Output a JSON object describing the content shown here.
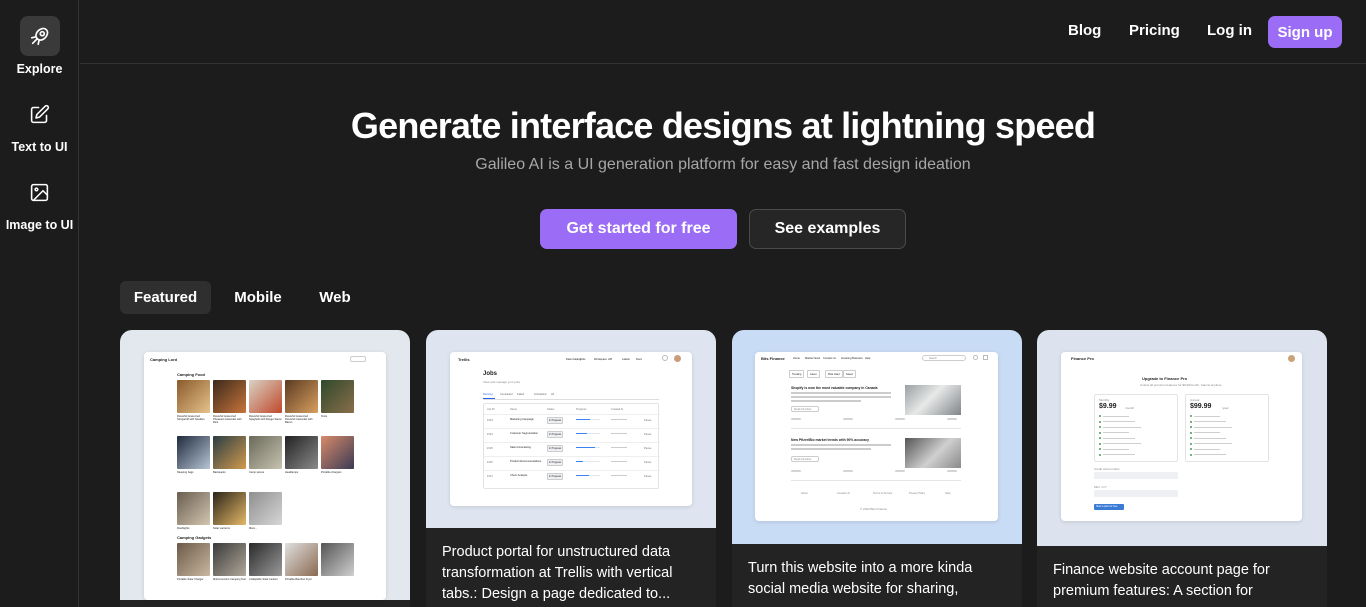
{
  "sidebar": {
    "items": [
      {
        "label": "Explore",
        "icon": "explore-icon",
        "active": true
      },
      {
        "label": "Text to UI",
        "icon": "edit-icon",
        "active": false
      },
      {
        "label": "Image to UI",
        "icon": "image-icon",
        "active": false
      }
    ]
  },
  "header": {
    "nav": {
      "blog": "Blog",
      "pricing": "Pricing",
      "login": "Log in",
      "signup": "Sign up"
    }
  },
  "hero": {
    "title": "Generate interface designs at lightning speed",
    "subtitle": "Galileo AI is a UI generation platform for easy and fast design ideation",
    "cta_primary": "Get started for free",
    "cta_secondary": "See examples"
  },
  "tabs": [
    {
      "label": "Featured",
      "active": true
    },
    {
      "label": "Mobile",
      "active": false
    },
    {
      "label": "Web",
      "active": false
    }
  ],
  "colors": {
    "accent": "#9b6cf5",
    "background": "#1c1c1c"
  },
  "cards": [
    {
      "caption": "",
      "preview": {
        "brand": "Camping Lord",
        "section1": "Camping Food",
        "section2": "Camping Gadgets",
        "food_items": [
          "Flavorful Grass-Fed Stroganoff with Noodles",
          "Flavorful Grass-Fed Pheasant Cassoulet with Rice",
          "Flavorful Grass-Fed Spaghetti with Rouge Sauce",
          "Flavorful Grass-Fed Flavorful Cassoulet with Bacon",
          "Tents",
          "Sleeping bags",
          "Backpacks",
          "Camp stoves",
          "Headlamps",
          "Portable chargers",
          "Flashlights",
          "Solar Lanterns",
          "More..."
        ],
        "gadget_items": [
          "Portable Solar Charger",
          "Multi-Function Camping Tool",
          "Collapsible Solar Lantern",
          "Portable Bamboo Fryer"
        ]
      }
    },
    {
      "caption": "Product portal for unstructured data transformation at Trellis with vertical tabs.: Design a page dedicated to...",
      "preview": {
        "brand": "Trellis",
        "nav": [
          "Data Catalog",
          "Jobs",
          "Workspace",
          "API",
          "Labels",
          "Docs"
        ],
        "title": "Jobs",
        "subtitle": "View and manage your jobs",
        "tabs": [
          "Running",
          "Completed",
          "Failed",
          "Scheduled",
          "All"
        ],
        "columns": [
          "Job ID",
          "Name",
          "Status",
          "Progress",
          "Created At",
          ""
        ],
        "rows": [
          {
            "id": "#123",
            "name": "Marketing Campaign",
            "status": "In Progress",
            "progress": 0.6
          },
          {
            "id": "#124",
            "name": "Customer Segmentation",
            "status": "In Progress",
            "progress": 0.45
          },
          {
            "id": "#125",
            "name": "Sales Forecasting",
            "status": "In Progress",
            "progress": 0.8
          },
          {
            "id": "#126",
            "name": "Product Recommendations",
            "status": "In Progress",
            "progress": 0.3
          },
          {
            "id": "#127",
            "name": "Churn Analysis",
            "status": "In Progress",
            "progress": 0.55
          }
        ],
        "row_action": "Pause"
      }
    },
    {
      "caption": "Turn this website into a more kinda social media website for sharing,",
      "preview": {
        "brand": "Bits Finance",
        "nav": [
          "Home",
          "Market News",
          "Contact Us",
          "Investing Business",
          "Help"
        ],
        "search": "Search",
        "filters": [
          "Trending",
          "Latest",
          "Most Liked",
          "Saved"
        ],
        "posts": [
          {
            "title": "Shopify is now the most valuable company in Canada",
            "cta": "Read full article"
          },
          {
            "title": "New Pfizer/Bio market trends with 90% accuracy",
            "cta": "Read full article"
          }
        ],
        "footer": [
          "About",
          "Contact Us",
          "Terms of Service",
          "Privacy Policy",
          "Help"
        ],
        "copyright": "© 2023 Bits Finance"
      }
    },
    {
      "caption": "Finance website account page for premium features: A section for",
      "preview": {
        "brand": "Finance Pro",
        "title": "Upgrade to Finance Pro",
        "subtitle": "Unlock all premium features for $9.99/month. Cancel anytime.",
        "plans": [
          {
            "name": "Monthly",
            "price": "$9.99",
            "period": "/month"
          },
          {
            "name": "Annual",
            "price": "$99.99",
            "period": "/year"
          }
        ],
        "field1": "Credit card number",
        "field2": "Mfor / CY",
        "button": "Start a plan for free"
      }
    }
  ]
}
